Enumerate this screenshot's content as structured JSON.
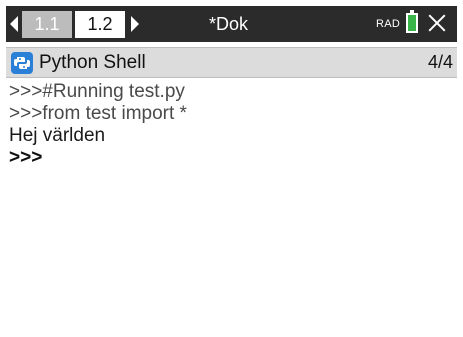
{
  "topbar": {
    "tabs": [
      {
        "label": "1.1",
        "active": false
      },
      {
        "label": "1.2",
        "active": true
      }
    ],
    "document_title": "*Dok",
    "angle_mode": "RAD",
    "battery_color": "#39b54a",
    "icons": [
      "arrow-left-icon",
      "arrow-right-icon",
      "battery-icon",
      "close-icon"
    ]
  },
  "app_header": {
    "title": "Python Shell",
    "page_counter": "4/4",
    "icon": "python-icon"
  },
  "shell": {
    "lines": [
      ">>>#Running test.py",
      ">>>from test import *",
      "Hej världen",
      ">>>"
    ]
  },
  "colors": {
    "topbar_bg": "#2b2b2b",
    "header_bg": "#dcdcdc",
    "accent_blue": "#2a7fd6"
  }
}
